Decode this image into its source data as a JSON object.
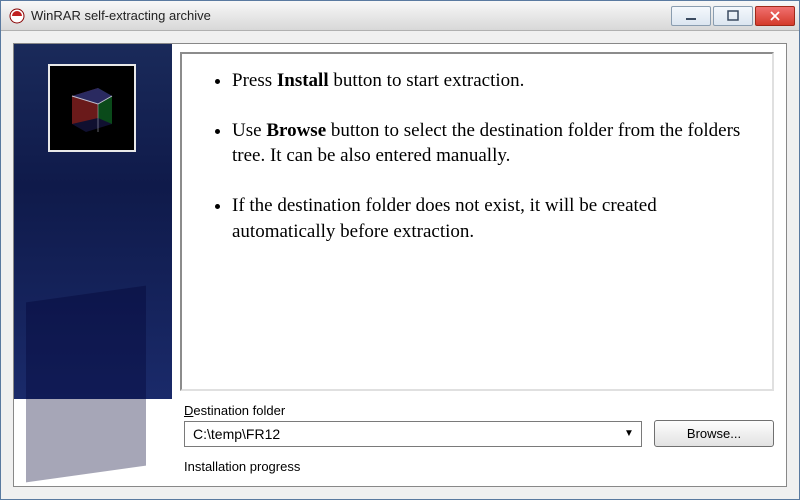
{
  "window": {
    "title": "WinRAR self-extracting archive"
  },
  "instructions": {
    "item1_pre": "Press ",
    "item1_bold": "Install",
    "item1_post": " button to start extraction.",
    "item2_pre": "Use ",
    "item2_bold": "Browse",
    "item2_post": " button to select the destination folder from the folders tree. It can be also entered manually.",
    "item3": "If the destination folder does not exist, it will be created automatically before extraction."
  },
  "destination": {
    "label_prefix_underline": "D",
    "label_rest": "estination folder",
    "value": "C:\\temp\\FR12",
    "browse_label": "Browse..."
  },
  "progress": {
    "label": "Installation progress"
  }
}
